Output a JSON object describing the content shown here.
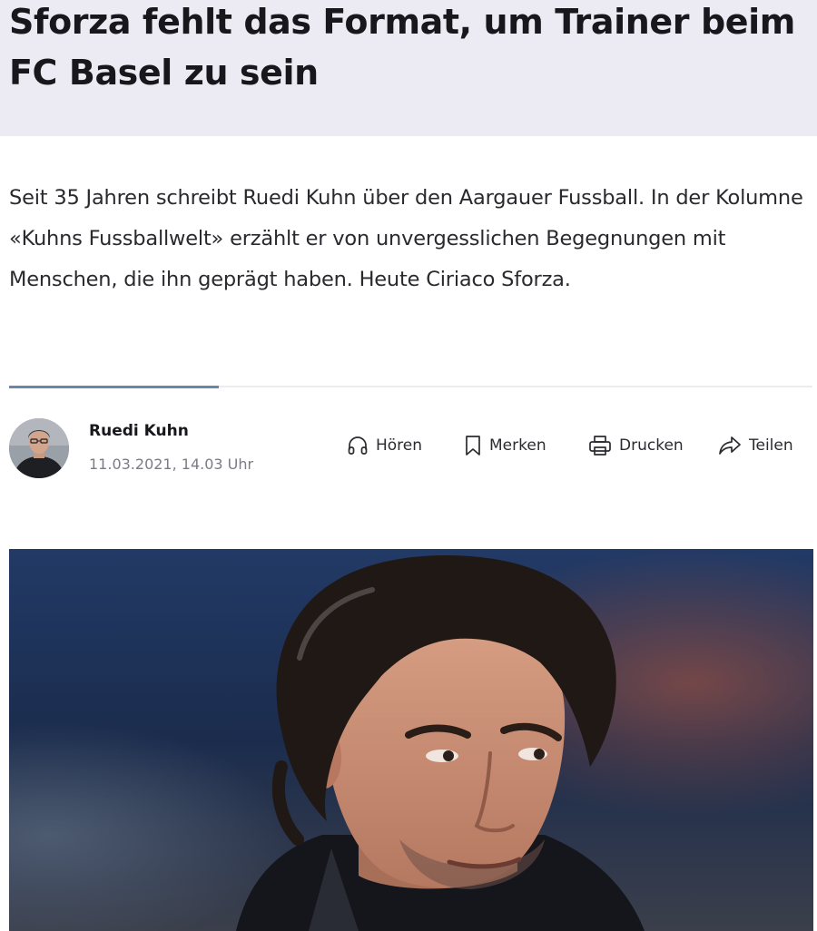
{
  "article": {
    "title": "Sforza fehlt das Format, um Trainer beim FC Basel zu sein",
    "lead": "Seit 35 Jahren schreibt Ruedi Kuhn über den Aargauer Fussball. In der Kolumne «Kuhns Fussballwelt» erzählt er von unvergesslichen Begegnungen mit Menschen, die ihn geprägt haben. Heute Ciriaco Sforza."
  },
  "author": {
    "name": "Ruedi Kuhn",
    "date": "11.03.2021, 14.03 Uhr"
  },
  "actions": {
    "listen": {
      "label": "Hören",
      "icon": "headphones-icon"
    },
    "bookmark": {
      "label": "Merken",
      "icon": "bookmark-icon"
    },
    "print": {
      "label": "Drucken",
      "icon": "printer-icon"
    },
    "share": {
      "label": "Teilen",
      "icon": "share-arrow-icon"
    }
  },
  "colors": {
    "headline_band": "#ecebf3",
    "divider_accent": "#6a87a8",
    "text": "#17171c",
    "meta": "#7c7c86"
  }
}
